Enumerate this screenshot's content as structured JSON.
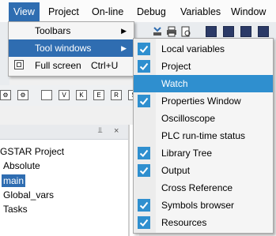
{
  "menubar": {
    "items": [
      {
        "label": "View"
      },
      {
        "label": "Project"
      },
      {
        "label": "On-line"
      },
      {
        "label": "Debug"
      },
      {
        "label": "Variables"
      },
      {
        "label": "Window"
      }
    ]
  },
  "view_menu": {
    "items": [
      {
        "label": "Toolbars",
        "has_submenu": true
      },
      {
        "label": "Tool windows",
        "has_submenu": true
      },
      {
        "label": "Full screen",
        "shortcut": "Ctrl+U"
      }
    ]
  },
  "tool_windows": {
    "items": [
      {
        "label": "Local variables",
        "checked": true
      },
      {
        "label": "Project",
        "checked": true
      },
      {
        "label": "Watch",
        "checked": false
      },
      {
        "label": "Properties Window",
        "checked": true
      },
      {
        "label": "Oscilloscope",
        "checked": false
      },
      {
        "label": "PLC run-time status",
        "checked": false
      },
      {
        "label": "Library Tree",
        "checked": true
      },
      {
        "label": "Output",
        "checked": true
      },
      {
        "label": "Cross Reference",
        "checked": false
      },
      {
        "label": "Symbols browser",
        "checked": true
      },
      {
        "label": "Resources",
        "checked": true
      }
    ]
  },
  "project_tree": {
    "root": "GSTAR Project",
    "items": [
      "Absolute",
      "main",
      "Global_vars",
      "Tasks"
    ]
  },
  "ladder_toolbar": {
    "labels": [
      "V",
      "K",
      "E",
      "R",
      "S"
    ]
  },
  "pane": {
    "pin_glyph": "⫫",
    "close_glyph": "×"
  },
  "colors": {
    "accent": "#2f6db1",
    "highlight": "#2f8fcf"
  }
}
